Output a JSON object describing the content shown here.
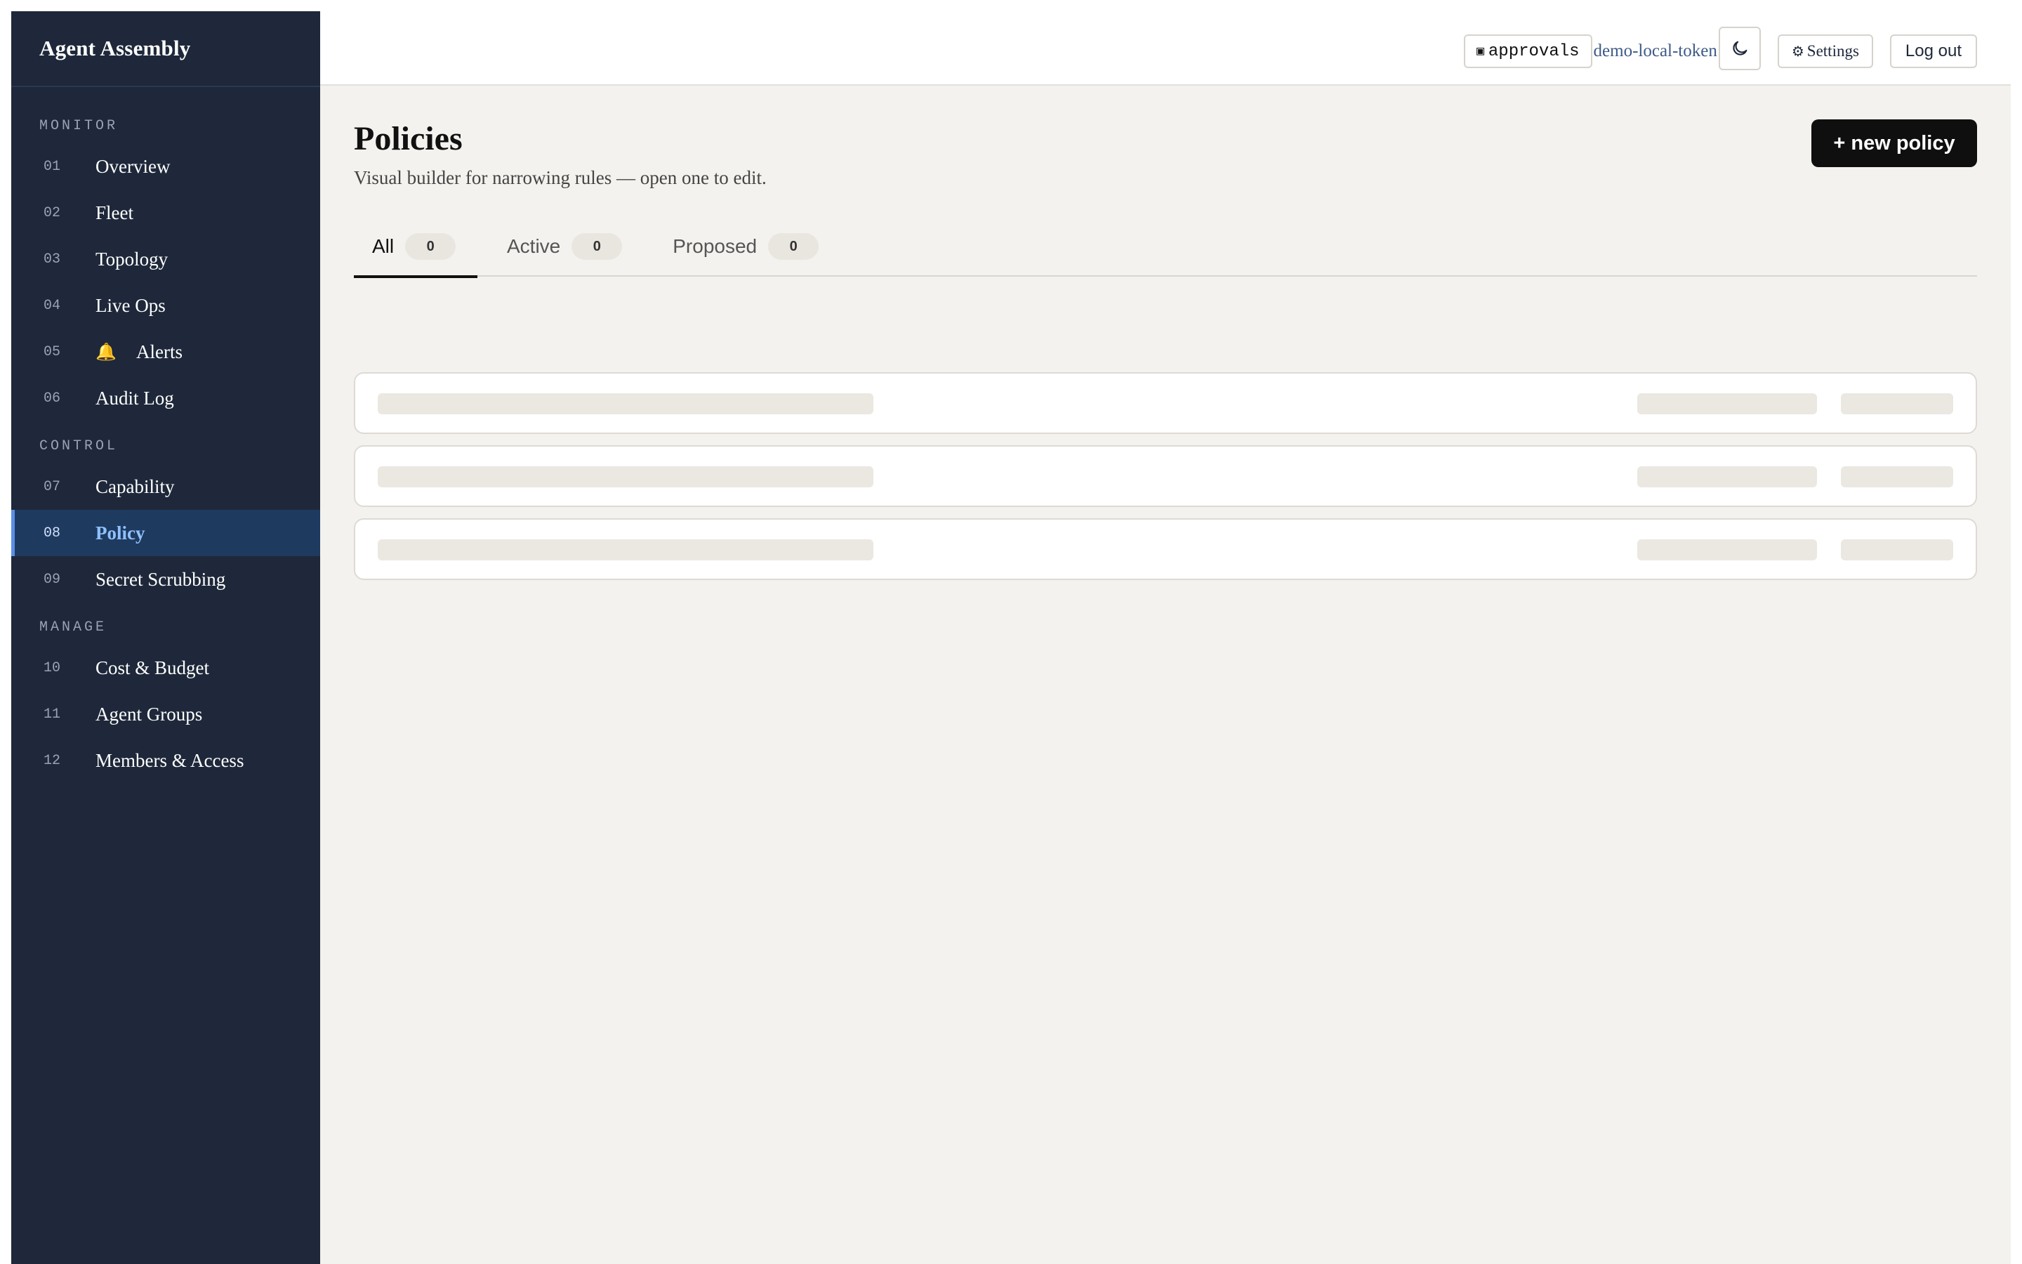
{
  "app": {
    "brand": "Agent Assembly"
  },
  "sidebar": {
    "sections": [
      {
        "label": "MONITOR"
      },
      {
        "label": "CONTROL"
      },
      {
        "label": "MANAGE"
      }
    ],
    "items": [
      {
        "num": "01",
        "label": "Overview"
      },
      {
        "num": "02",
        "label": "Fleet"
      },
      {
        "num": "03",
        "label": "Topology"
      },
      {
        "num": "04",
        "label": "Live Ops"
      },
      {
        "num": "05",
        "label": "Alerts",
        "icon": "bell-icon"
      },
      {
        "num": "06",
        "label": "Audit Log"
      },
      {
        "num": "07",
        "label": "Capability"
      },
      {
        "num": "08",
        "label": "Policy",
        "active": true
      },
      {
        "num": "09",
        "label": "Secret Scrubbing"
      },
      {
        "num": "10",
        "label": "Cost & Budget"
      },
      {
        "num": "11",
        "label": "Agent Groups"
      },
      {
        "num": "12",
        "label": "Members & Access"
      }
    ]
  },
  "topbar": {
    "approvals_icon": "▣",
    "approvals_label": "approvals",
    "token": "demo-local-token",
    "theme_icon": "moon-icon",
    "settings_icon": "⚙",
    "settings_label": "Settings",
    "logout_label": "Log out"
  },
  "page": {
    "title": "Policies",
    "subtitle": "Visual builder for narrowing rules — open one to edit.",
    "new_button": "+ new policy",
    "tabs": [
      {
        "label": "All",
        "count": "0"
      },
      {
        "label": "Active",
        "count": "0"
      },
      {
        "label": "Proposed",
        "count": "0"
      }
    ]
  },
  "colors": {
    "sidebar_bg": "#1e283a",
    "active_item_bg": "#1f3a5f",
    "active_text": "#8fc1ff",
    "page_bg": "#f4f2ee",
    "primary_button": "#0f0f0f",
    "skeleton": "#ebe8e2"
  }
}
